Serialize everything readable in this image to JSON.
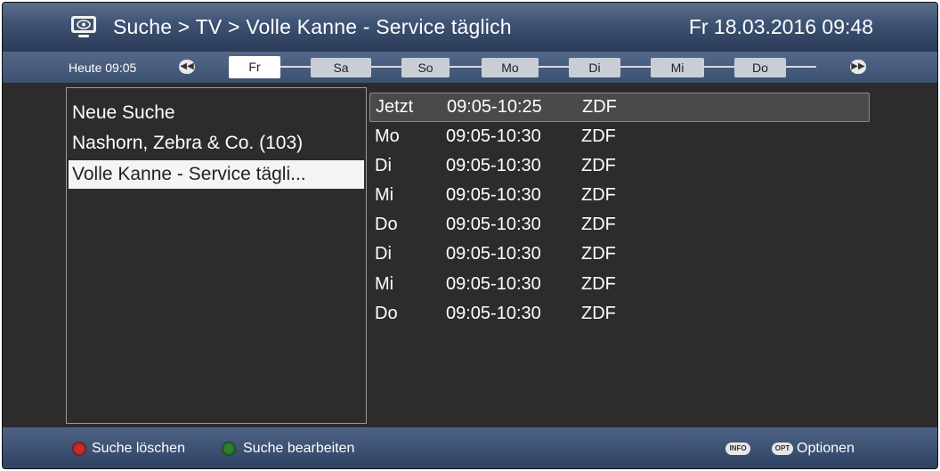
{
  "header": {
    "breadcrumb": "Suche > TV > Volle Kanne - Service täglich",
    "datetime": "Fr 18.03.2016  09:48",
    "icon": "tv-icon"
  },
  "daybar": {
    "today_label": "Heute 09:05",
    "prev_icon": "rewind-icon",
    "next_icon": "fast-forward-icon",
    "days": [
      "Fr",
      "Sa",
      "So",
      "Mo",
      "Di",
      "Mi",
      "Do"
    ],
    "active_day": "Fr"
  },
  "searches": [
    {
      "label": "Neue Suche"
    },
    {
      "label": "Nashorn, Zebra & Co. (103)"
    },
    {
      "label": "Volle Kanne - Service tägli..."
    }
  ],
  "results": [
    {
      "day": "Jetzt",
      "time": "09:05-10:25",
      "channel": "ZDF"
    },
    {
      "day": "Mo",
      "time": "09:05-10:30",
      "channel": "ZDF"
    },
    {
      "day": "Di",
      "time": "09:05-10:30",
      "channel": "ZDF"
    },
    {
      "day": "Mi",
      "time": "09:05-10:30",
      "channel": "ZDF"
    },
    {
      "day": "Do",
      "time": "09:05-10:30",
      "channel": "ZDF"
    },
    {
      "day": "Di",
      "time": "09:05-10:30",
      "channel": "ZDF"
    },
    {
      "day": "Mi",
      "time": "09:05-10:30",
      "channel": "ZDF"
    },
    {
      "day": "Do",
      "time": "09:05-10:30",
      "channel": "ZDF"
    }
  ],
  "footer": {
    "red_label": "Suche löschen",
    "green_label": "Suche bearbeiten",
    "info_key": "INFO",
    "opt_key": "OPT",
    "opt_label": "Optionen"
  },
  "colors": {
    "red_button": "#c62d2d",
    "green_button": "#2f7d2f",
    "bar_blue": "#3d5172"
  }
}
